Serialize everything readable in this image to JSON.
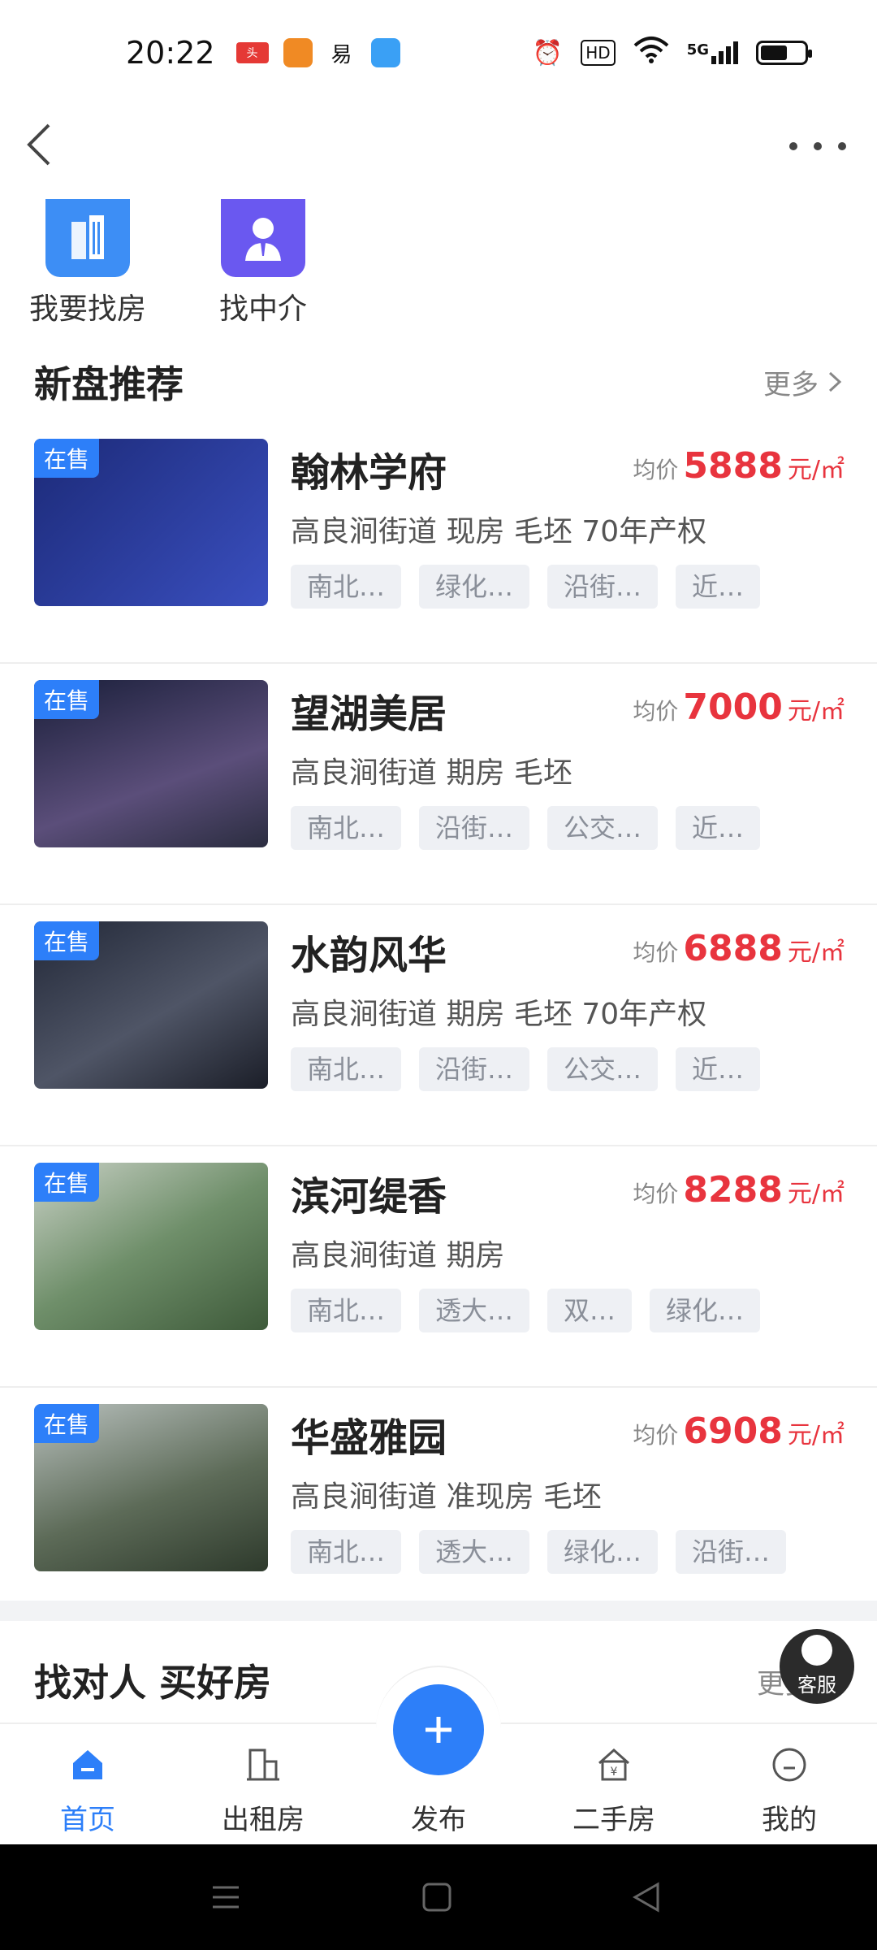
{
  "status_bar": {
    "time": "20:22",
    "icons": [
      "toutiao-icon",
      "app-icon",
      "app-icon-2",
      "weather-icon"
    ],
    "right_icons": [
      "alarm-icon",
      "hd-icon",
      "wifi-icon",
      "signal-5g-icon",
      "battery-icon"
    ],
    "hd_label": "HD",
    "network_label": "5G"
  },
  "quick_entries": [
    {
      "label": "我要找房",
      "icon": "building-icon",
      "color": "#3d8ef5"
    },
    {
      "label": "找中介",
      "icon": "agent-icon",
      "color": "#6a58f0"
    }
  ],
  "section_new": {
    "title": "新盘推荐",
    "more": "更多"
  },
  "listings": [
    {
      "tag": "在售",
      "name": "翰林学府",
      "price_label": "均价",
      "price": "5888",
      "unit": "元/㎡",
      "info": "高良涧街道  现房  毛坯  70年产权",
      "chips": [
        "南北…",
        "绿化…",
        "沿街…",
        "近…"
      ],
      "thumb_colors": [
        "#1c2a78",
        "#3a4fbf"
      ]
    },
    {
      "tag": "在售",
      "name": "望湖美居",
      "price_label": "均价",
      "price": "7000",
      "unit": "元/㎡",
      "info": "高良涧街道  期房  毛坯",
      "chips": [
        "南北…",
        "沿街…",
        "公交…",
        "近…"
      ],
      "thumb_colors": [
        "#1a1f3a",
        "#5b4e7a"
      ]
    },
    {
      "tag": "在售",
      "name": "水韵风华",
      "price_label": "均价",
      "price": "6888",
      "unit": "元/㎡",
      "info": "高良涧街道  期房  毛坯  70年产权",
      "chips": [
        "南北…",
        "沿街…",
        "公交…",
        "近…"
      ],
      "thumb_colors": [
        "#222838",
        "#4f5566"
      ]
    },
    {
      "tag": "在售",
      "name": "滨河缇香",
      "price_label": "均价",
      "price": "8288",
      "unit": "元/㎡",
      "info": "高良涧街道  期房",
      "chips": [
        "南北…",
        "透大…",
        "双…",
        "绿化…"
      ],
      "thumb_colors": [
        "#6f8f6a",
        "#c9d1c6"
      ]
    },
    {
      "tag": "在售",
      "name": "华盛雅园",
      "price_label": "均价",
      "price": "6908",
      "unit": "元/㎡",
      "info": "高良涧街道  准现房  毛坯",
      "chips": [
        "南北…",
        "透大…",
        "绿化…",
        "沿街…"
      ],
      "thumb_colors": [
        "#5d6b58",
        "#b8c0bd"
      ]
    }
  ],
  "section_agents": {
    "title": "找对人 买好房",
    "more": "更多"
  },
  "kefu_label": "客服",
  "tabbar": {
    "tabs": [
      {
        "label": "首页",
        "icon": "home-icon",
        "active": true
      },
      {
        "label": "出租房",
        "icon": "rent-icon",
        "active": false
      },
      {
        "label": "二手房",
        "icon": "secondhand-icon",
        "active": false
      },
      {
        "label": "我的",
        "icon": "profile-icon",
        "active": false
      }
    ],
    "publish_label": "发布",
    "publish_icon": "plus-icon"
  },
  "colors": {
    "accent": "#2d7ff9",
    "price": "#e8343e"
  }
}
